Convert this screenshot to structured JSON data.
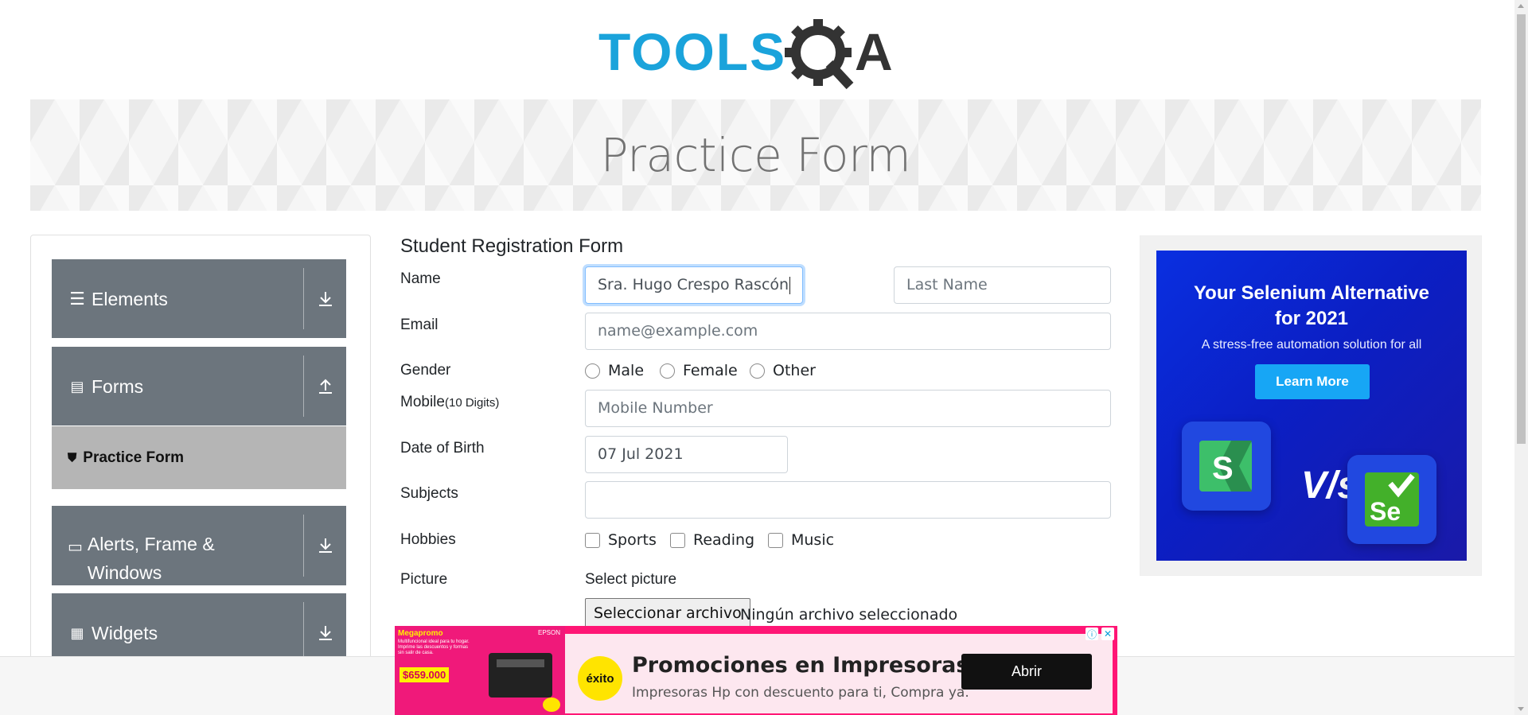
{
  "brand": {
    "logo_text": "TOOLSQA"
  },
  "banner": {
    "title": "Practice Form"
  },
  "sidebar": {
    "groups": [
      {
        "label": "Elements",
        "icon": "menu-icon",
        "toggle": "download-icon"
      },
      {
        "label": "Forms",
        "icon": "document-icon",
        "toggle": "upload-icon"
      },
      {
        "label": "Alerts, Frame & Windows",
        "icon": "window-icon",
        "toggle": "download-icon"
      },
      {
        "label": "Widgets",
        "icon": "widgets-icon",
        "toggle": "download-icon"
      }
    ],
    "active_item": {
      "label": "Practice Form",
      "icon": "html5-icon"
    }
  },
  "form": {
    "title": "Student Registration Form",
    "name_label": "Name",
    "first_name_value": "Sra. Hugo Crespo Rascón",
    "last_name_placeholder": "Last Name",
    "email_label": "Email",
    "email_placeholder": "name@example.com",
    "gender_label": "Gender",
    "gender_options": [
      "Male",
      "Female",
      "Other"
    ],
    "mobile_label": "Mobile",
    "mobile_hint": "(10 Digits)",
    "mobile_placeholder": "Mobile Number",
    "dob_label": "Date of Birth",
    "dob_value": "07 Jul 2021",
    "subjects_label": "Subjects",
    "subjects_value": "",
    "hobbies_label": "Hobbies",
    "hobby_options": [
      "Sports",
      "Reading",
      "Music"
    ],
    "picture_label": "Picture",
    "select_picture": "Select picture",
    "file_button": "Seleccionar archivo",
    "file_status": "Ningún archivo seleccionado"
  },
  "side_ad": {
    "headline_1": "Your Selenium Alternative",
    "headline_2": "for 2021",
    "subtitle": "A stress-free automation solution for all",
    "cta": "Learn More",
    "vs": "V/s",
    "left_logo": "S",
    "right_logo": "Se"
  },
  "bottom_ad": {
    "promo_label": "Megapromo",
    "promo_text": "Multifuncional ideal para tu hogar. Imprime las descuentos y formas sin salir de casa.",
    "promo_price": "$659.000",
    "brand": "EPSON",
    "logo": "éxito",
    "title": "Promociones en Impresoras HP",
    "description": "Impresoras Hp con descuento para ti, Compra ya.",
    "cta": "Abrir"
  },
  "colors": {
    "sidebar_group": "#6c757d",
    "sidebar_active": "#b5b5b5",
    "logo_blue": "#1aa3db",
    "logo_dark": "#333333",
    "ad_blue": "#0b2fe0",
    "ad_pink": "#ff1675"
  }
}
